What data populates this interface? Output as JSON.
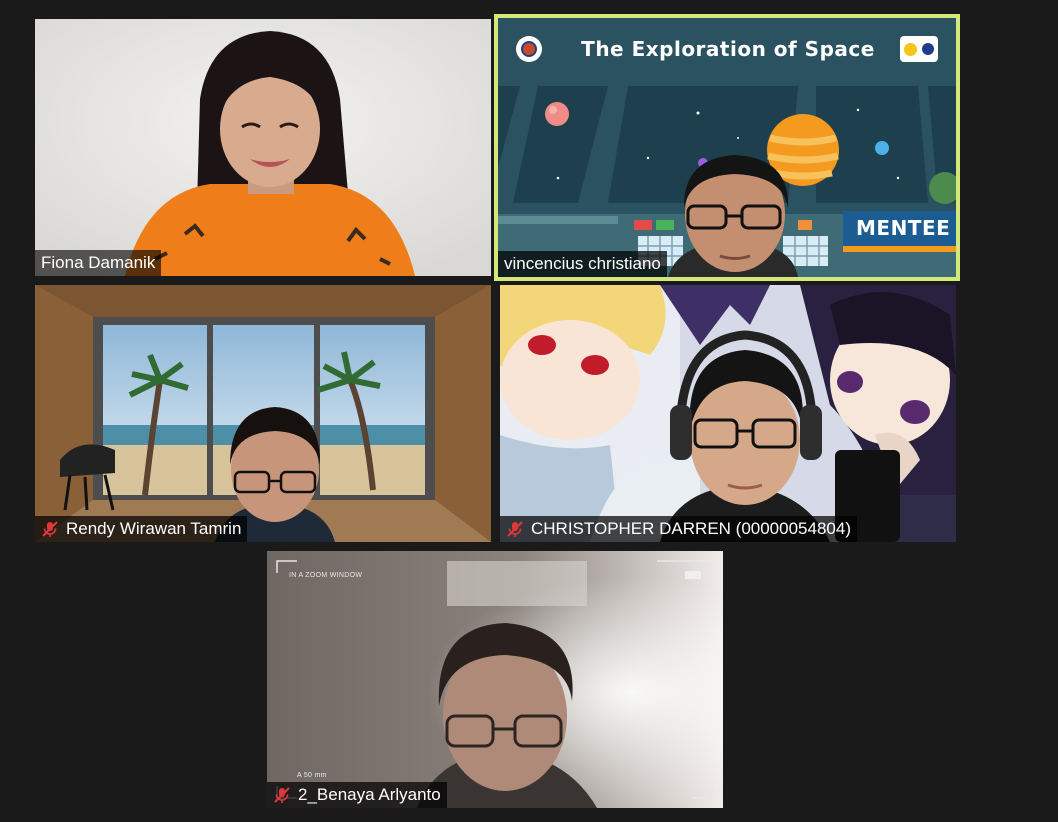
{
  "participants": [
    {
      "name": "Fiona Damanik",
      "muted": false,
      "active": false
    },
    {
      "name": "vincencius christiano",
      "muted": false,
      "active": true
    },
    {
      "name": "Rendy Wirawan Tamrin",
      "muted": true,
      "active": false
    },
    {
      "name": "CHRISTOPHER DARREN (00000054804)",
      "muted": true,
      "active": false
    },
    {
      "name": "2_Benaya Arlyanto",
      "muted": true,
      "active": false
    }
  ],
  "backgrounds": {
    "space": {
      "title": "The Exploration of Space",
      "badge": "MENTEE"
    },
    "zoom_window": {
      "label": "IN A ZOOM WINDOW",
      "lens": "A  50 mm"
    }
  },
  "colors": {
    "active_speaker_border": "#d3e878",
    "muted_icon": "#e0383a",
    "name_tag_bg": "rgba(0,0,0,0.72)"
  },
  "icons": [
    "microphone-muted-icon",
    "university-logo-icon",
    "partner-logo-icon"
  ]
}
